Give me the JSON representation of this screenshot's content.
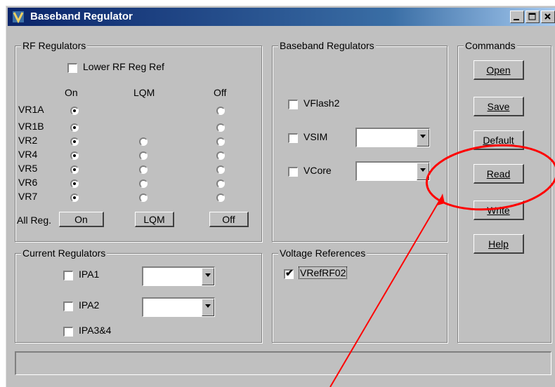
{
  "window": {
    "title": "Baseband Regulator"
  },
  "rf": {
    "legend": "RF Regulators",
    "lower_ref": {
      "label": "Lower RF Reg Ref",
      "checked": false
    },
    "cols": {
      "on": "On",
      "lqm": "LQM",
      "off": "Off"
    },
    "rows": [
      {
        "name": "VR1A",
        "selected": "on",
        "has_lqm": false
      },
      {
        "name": "VR1B",
        "selected": "on",
        "has_lqm": false
      },
      {
        "name": "VR2",
        "selected": "on",
        "has_lqm": true
      },
      {
        "name": "VR4",
        "selected": "on",
        "has_lqm": true
      },
      {
        "name": "VR5",
        "selected": "on",
        "has_lqm": true
      },
      {
        "name": "VR6",
        "selected": "on",
        "has_lqm": true
      },
      {
        "name": "VR7",
        "selected": "on",
        "has_lqm": true
      }
    ],
    "allreg": {
      "label": "All Reg.",
      "on": "On",
      "lqm": "LQM",
      "off": "Off"
    }
  },
  "baseband": {
    "legend": "Baseband Regulators",
    "vflash2": "VFlash2",
    "vsim": "VSIM",
    "vcore": "VCore"
  },
  "current": {
    "legend": "Current Regulators",
    "ipa1": "IPA1",
    "ipa2": "IPA2",
    "ipa34": "IPA3&4"
  },
  "voltage": {
    "legend": "Voltage References",
    "vref": {
      "label": "VRefRF02",
      "checked": true
    }
  },
  "commands": {
    "legend": "Commands",
    "open": "Open",
    "save": "Save",
    "default": "Default",
    "read": "Read",
    "write": "Write",
    "help": "Help"
  },
  "colors": {
    "annotation": "#ff0000",
    "titlebar": "#0a246a",
    "face": "#c0c0c0"
  }
}
